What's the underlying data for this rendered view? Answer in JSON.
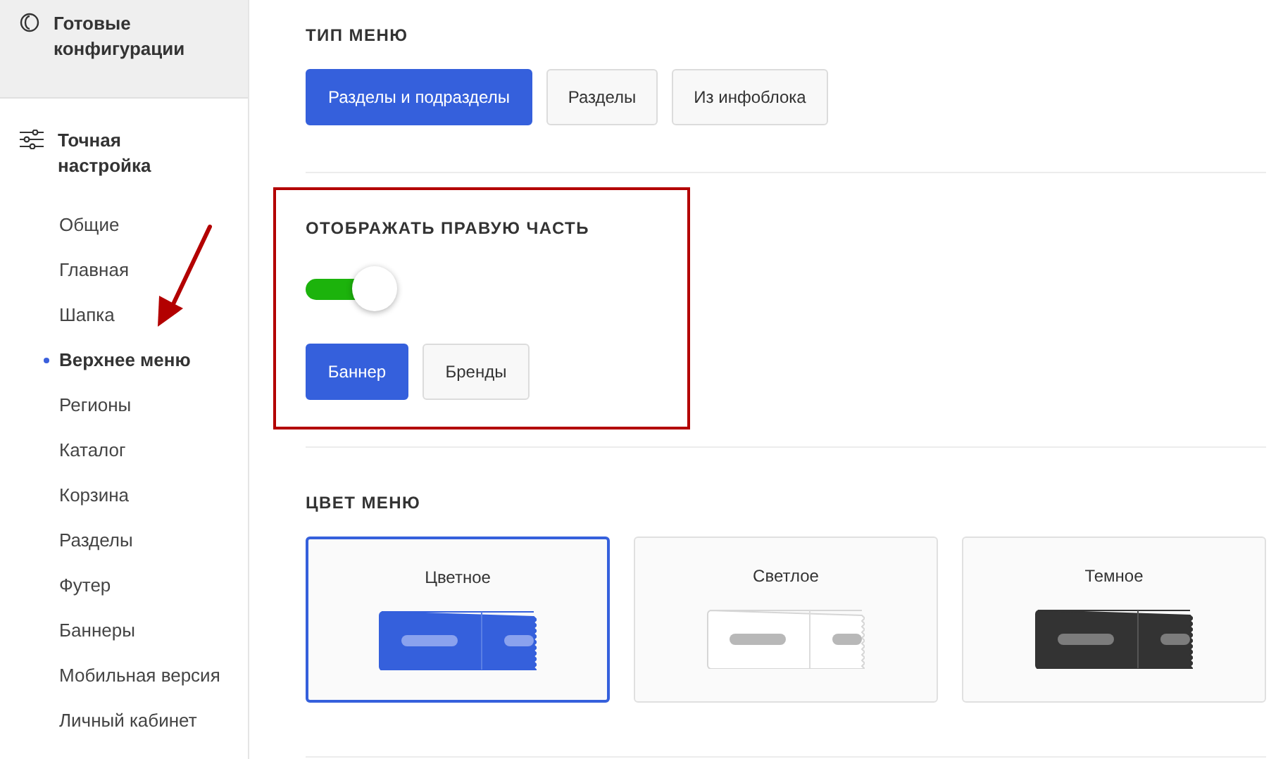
{
  "sidebar": {
    "sections": [
      {
        "kind": "presets",
        "title": "Готовые конфигурации",
        "expanded": false
      },
      {
        "kind": "tuning",
        "title": "Точная настройка",
        "expanded": true,
        "items": [
          {
            "label": "Общие",
            "selected": false
          },
          {
            "label": "Главная",
            "selected": false
          },
          {
            "label": "Шапка",
            "selected": false
          },
          {
            "label": "Верхнее меню",
            "selected": true
          },
          {
            "label": "Регионы",
            "selected": false
          },
          {
            "label": "Каталог",
            "selected": false
          },
          {
            "label": "Корзина",
            "selected": false
          },
          {
            "label": "Разделы",
            "selected": false
          },
          {
            "label": "Футер",
            "selected": false
          },
          {
            "label": "Баннеры",
            "selected": false
          },
          {
            "label": "Мобильная версия",
            "selected": false
          },
          {
            "label": "Личный кабинет",
            "selected": false
          }
        ]
      }
    ]
  },
  "menu_type": {
    "title": "ТИП МЕНЮ",
    "options": [
      {
        "label": "Разделы и подразделы",
        "selected": true
      },
      {
        "label": "Разделы",
        "selected": false
      },
      {
        "label": "Из инфоблока",
        "selected": false
      }
    ]
  },
  "right_part": {
    "title": "ОТОБРАЖАТЬ ПРАВУЮ ЧАСТЬ",
    "highlighted": true,
    "on": true,
    "options": [
      {
        "label": "Баннер",
        "selected": true
      },
      {
        "label": "Бренды",
        "selected": false
      }
    ]
  },
  "menu_color": {
    "title": "ЦВЕТ МЕНЮ",
    "options": [
      {
        "label": "Цветное",
        "kind": "colored",
        "selected": true
      },
      {
        "label": "Светлое",
        "kind": "light",
        "selected": false
      },
      {
        "label": "Темное",
        "kind": "dark",
        "selected": false
      }
    ]
  }
}
